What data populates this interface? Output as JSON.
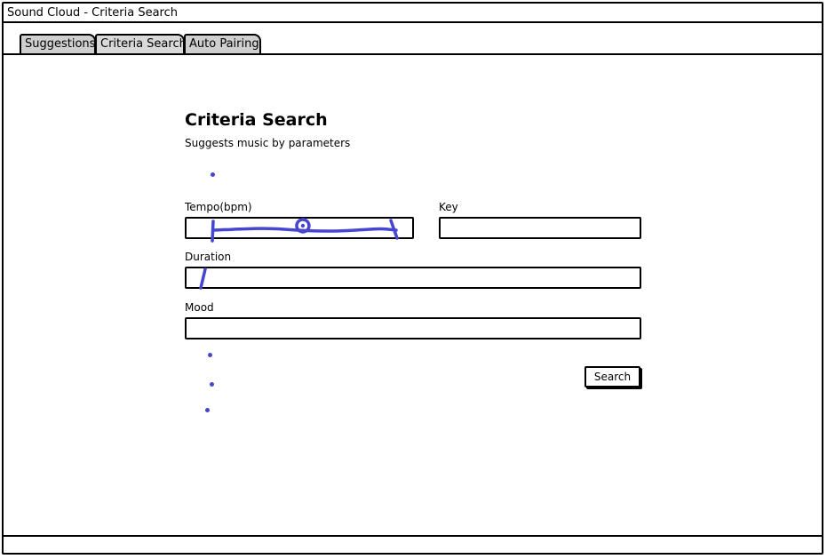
{
  "window": {
    "title": "Sound Cloud - Criteria Search"
  },
  "tabs": [
    {
      "label": "Suggestions",
      "active": false
    },
    {
      "label": "Criteria Search",
      "active": true
    },
    {
      "label": "Auto Pairing",
      "active": false
    }
  ],
  "page": {
    "title": "Criteria Search",
    "subtitle": "Suggests music by parameters"
  },
  "form": {
    "tempo": {
      "label": "Tempo(bpm)",
      "slider_position": 0.49
    },
    "key": {
      "label": "Key",
      "value": ""
    },
    "duration": {
      "label": "Duration",
      "value": ""
    },
    "mood": {
      "label": "Mood",
      "value": ""
    },
    "search_button": {
      "label": "Search"
    }
  },
  "colors": {
    "annotation": "#4646cf",
    "tab_fill": "#cfcfcf",
    "border": "#000000"
  }
}
